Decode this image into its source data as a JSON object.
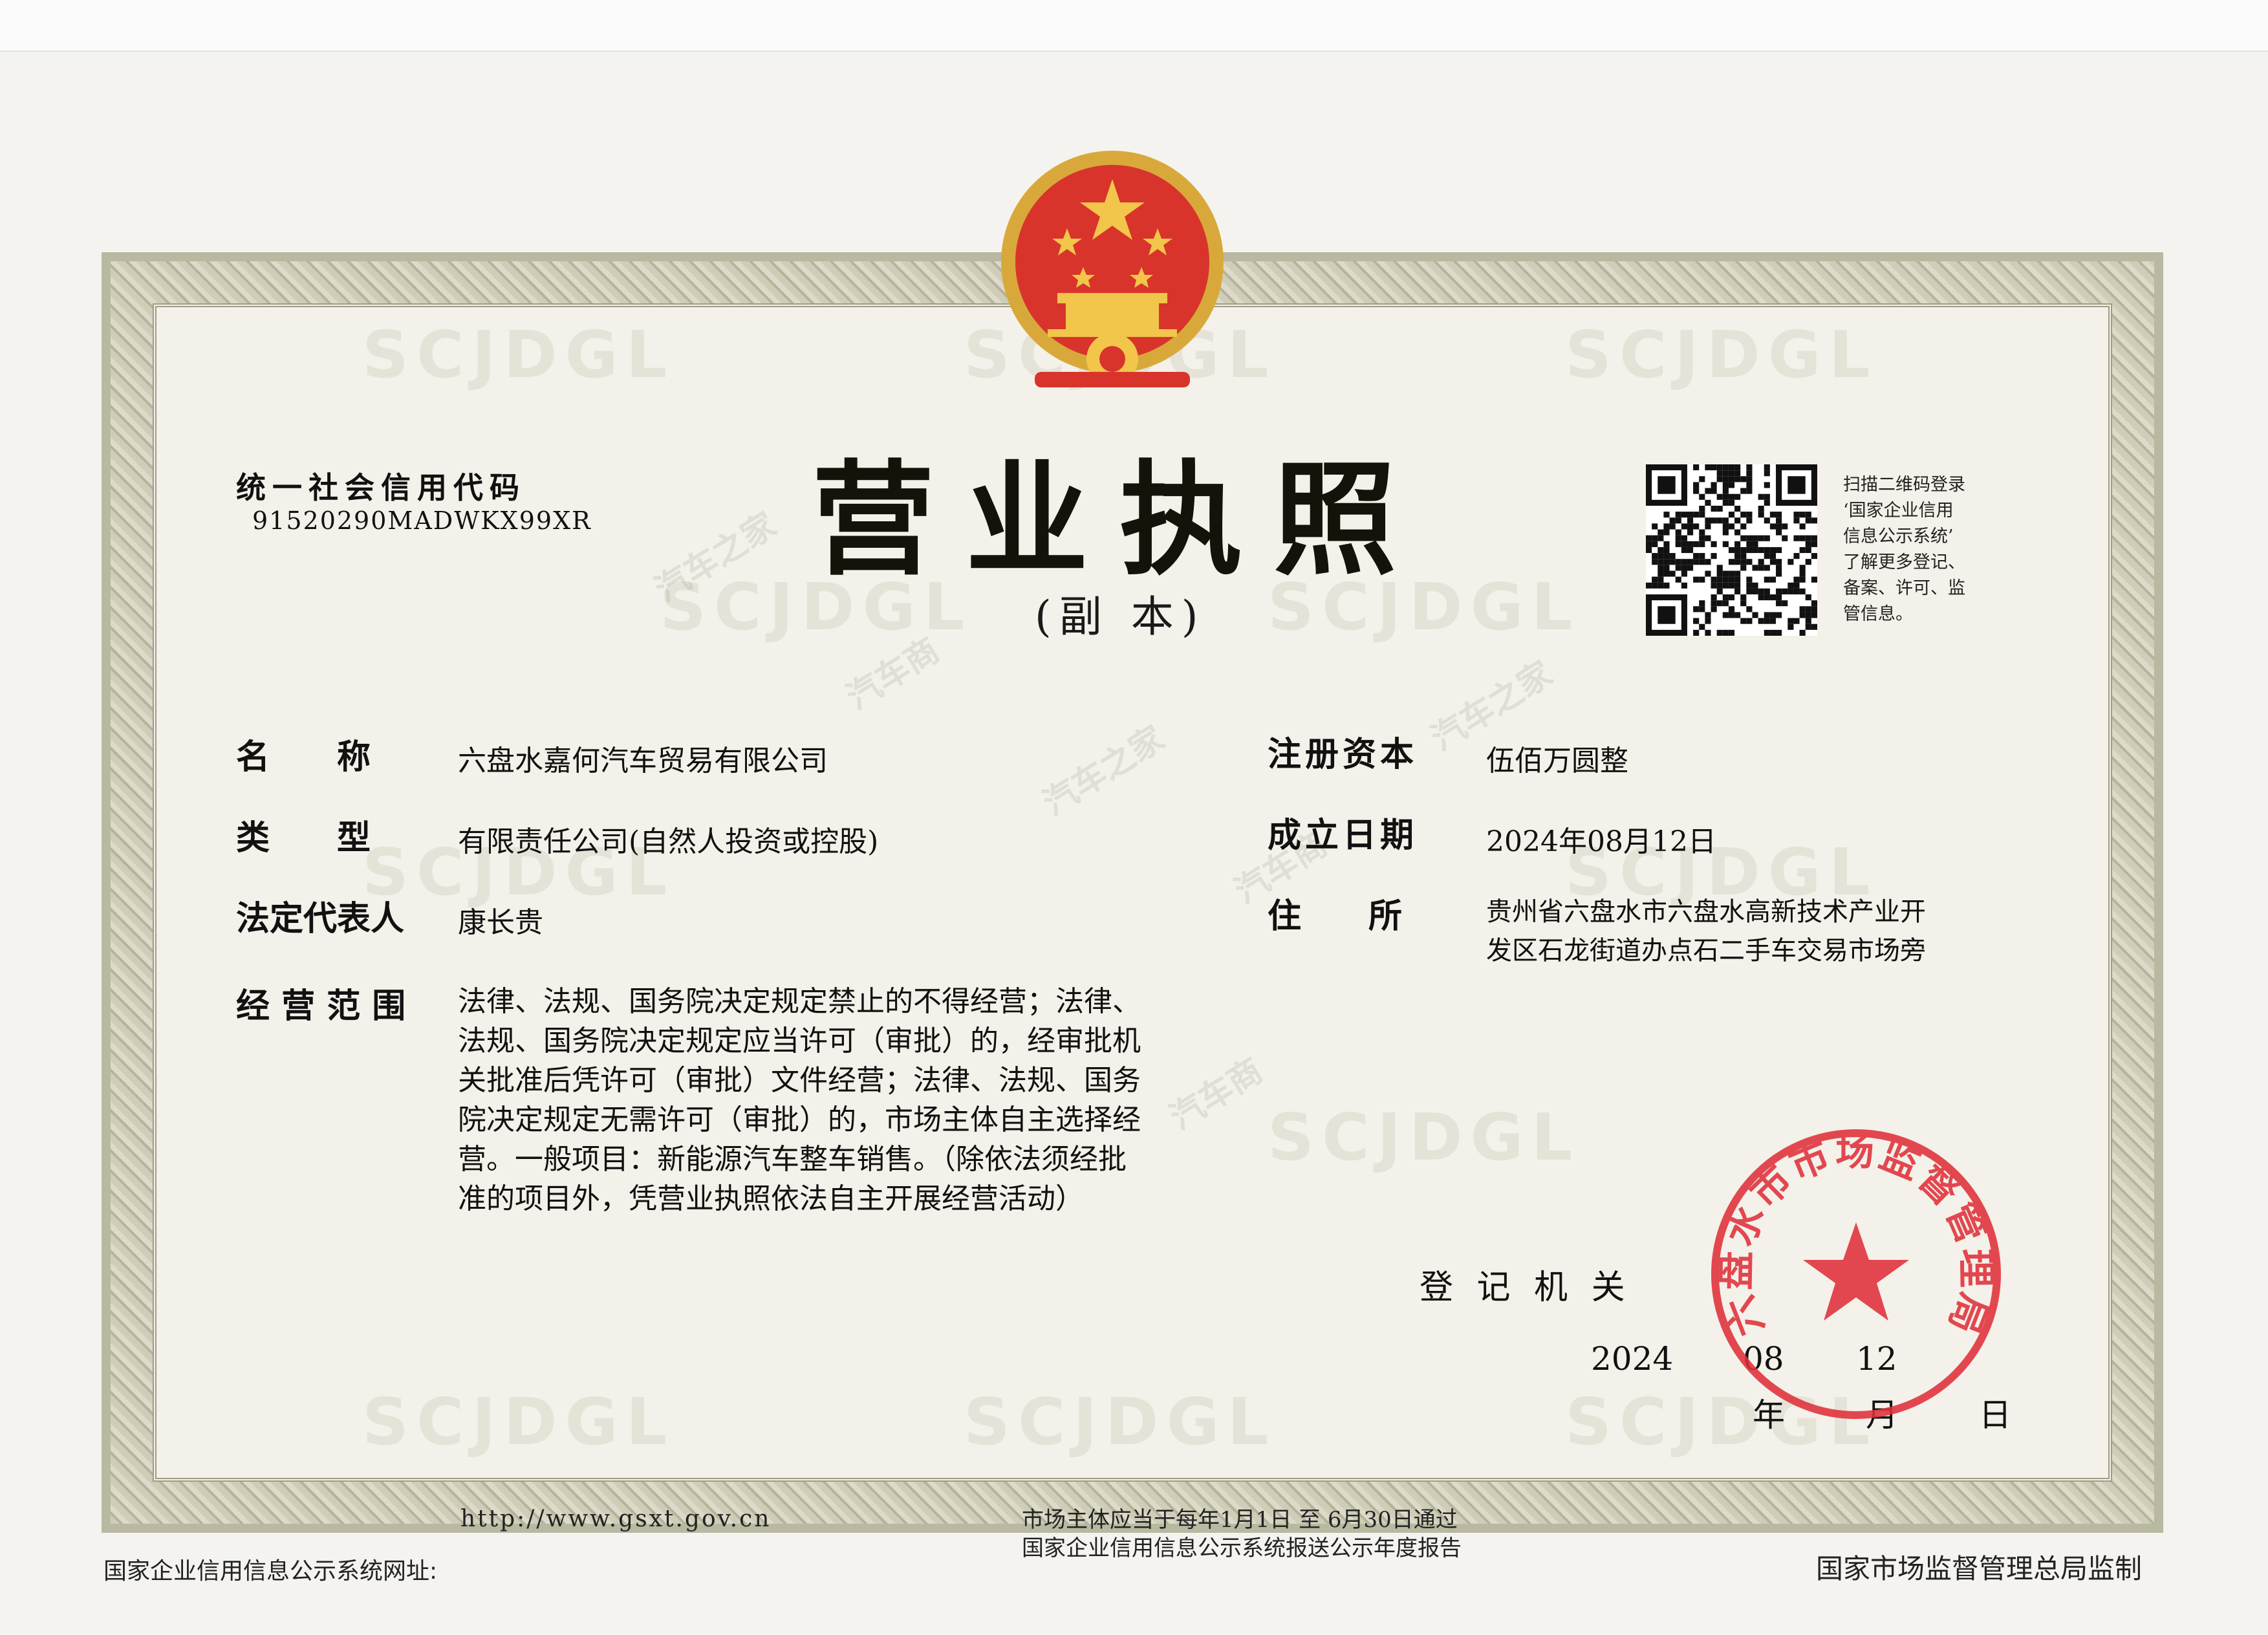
{
  "license": {
    "credit_code_label": "统一社会信用代码",
    "credit_code": "91520290MADWKX99XR",
    "title": "营业执照",
    "subtitle": "(副 本)",
    "qr_note": [
      "扫描二维码登录",
      "‘国家企业信用",
      "信息公示系统’",
      "了解更多登记、",
      "备案、许可、监",
      "管信息。"
    ]
  },
  "fields": {
    "name_label": "名　　称",
    "name": "六盘水嘉何汽车贸易有限公司",
    "type_label": "类　　型",
    "type": "有限责任公司(自然人投资或控股)",
    "rep_label": "法定代表人",
    "rep": "康长贵",
    "scope_label": "经 营 范 围",
    "scope_lines": [
      "法律、法规、国务院决定规定禁止的不得经营；法律、",
      "法规、国务院决定规定应当许可（审批）的，经审批机",
      "关批准后凭许可（审批）文件经营；法律、法规、国务",
      "院决定规定无需许可（审批）的，市场主体自主选择经",
      "营。一般项目：新能源汽车整车销售。（除依法须经批",
      "准的项目外，凭营业执照依法自主开展经营活动）"
    ],
    "capital_label": "注册资本",
    "capital": "伍佰万圆整",
    "date_label": "成立日期",
    "date": "2024年08月12日",
    "address_label": "住　　所",
    "address_lines": [
      "贵州省六盘水市六盘水高新技术产业开",
      "发区石龙街道办点石二手车交易市场旁"
    ]
  },
  "authority": {
    "label": "登 记 机 关",
    "year": "2024",
    "month": "08",
    "day": "12",
    "year_char": "年",
    "month_char": "月",
    "day_char": "日",
    "seal_text": "六盘水市市场监督管理局"
  },
  "footer": {
    "url": "http://www.gsxt.gov.cn",
    "notice_line1": "市场主体应当于每年1月1日 至 6月30日通过",
    "notice_line2": "国家企业信用信息公示系统报送公示年度报告",
    "site_label": "国家企业信用信息公示系统网址:",
    "supervisor": "国家市场监督管理总局监制"
  },
  "watermarks": {
    "pattern": "SCJDGL",
    "diag_a": "汽车之家",
    "diag_b": "汽车商"
  },
  "colors": {
    "emblem_red": "#d8342c",
    "emblem_gold": "#d8a93a",
    "seal_red": "#e0303a"
  }
}
